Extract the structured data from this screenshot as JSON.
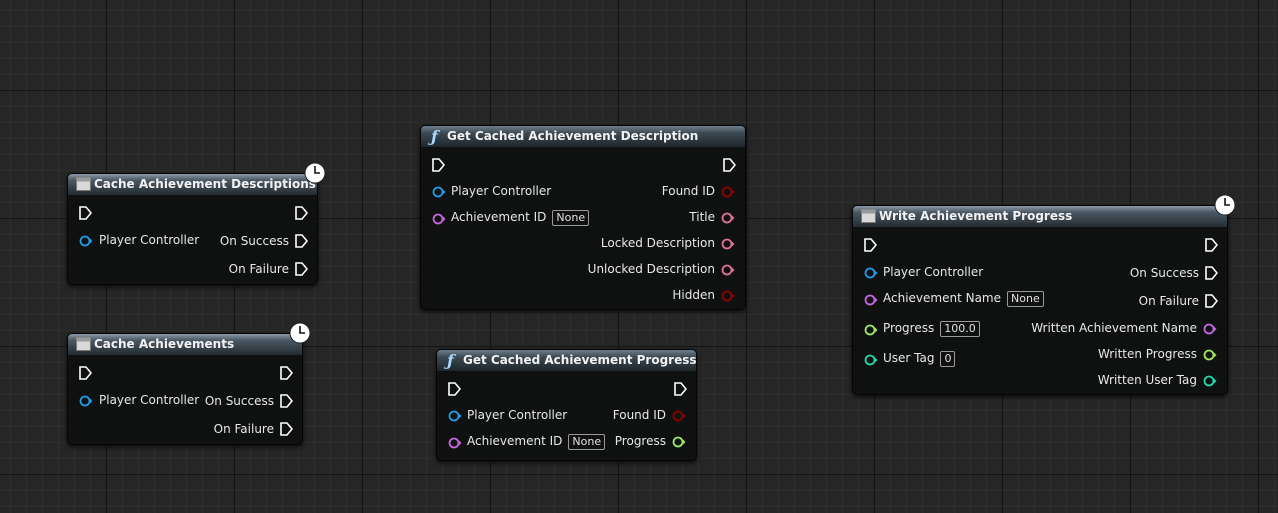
{
  "nodes": {
    "cache_desc": {
      "title": "Cache Achievement Descriptions",
      "player_controller": "Player Controller",
      "on_success": "On Success",
      "on_failure": "On Failure"
    },
    "cache_ach": {
      "title": "Cache Achievements",
      "player_controller": "Player Controller",
      "on_success": "On Success",
      "on_failure": "On Failure"
    },
    "get_desc": {
      "title": "Get Cached Achievement Description",
      "player_controller": "Player Controller",
      "achievement_id": "Achievement ID",
      "achievement_id_value": "None",
      "found_id": "Found ID",
      "title_out": "Title",
      "locked_description": "Locked Description",
      "unlocked_description": "Unlocked Description",
      "hidden": "Hidden"
    },
    "get_progress": {
      "title": "Get Cached Achievement Progress",
      "player_controller": "Player Controller",
      "achievement_id": "Achievement ID",
      "achievement_id_value": "None",
      "found_id": "Found ID",
      "progress": "Progress"
    },
    "write_progress": {
      "title": "Write Achievement Progress",
      "player_controller": "Player Controller",
      "achievement_name": "Achievement Name",
      "achievement_name_value": "None",
      "progress": "Progress",
      "progress_value": "100.0",
      "user_tag": "User Tag",
      "user_tag_value": "0",
      "on_success": "On Success",
      "on_failure": "On Failure",
      "written_achievement_name": "Written Achievement Name",
      "written_progress": "Written Progress",
      "written_user_tag": "Written User Tag"
    }
  },
  "pin_colors": {
    "exec": "#ffffff",
    "object": "#1e9ae6",
    "name": "#c466e0",
    "bool": "#8c0000",
    "text": "#e07098",
    "float": "#a0e660",
    "int": "#22d7aa"
  },
  "icons": {
    "latent": "clock-icon",
    "macro": "macro-icon",
    "function": "function-icon"
  }
}
